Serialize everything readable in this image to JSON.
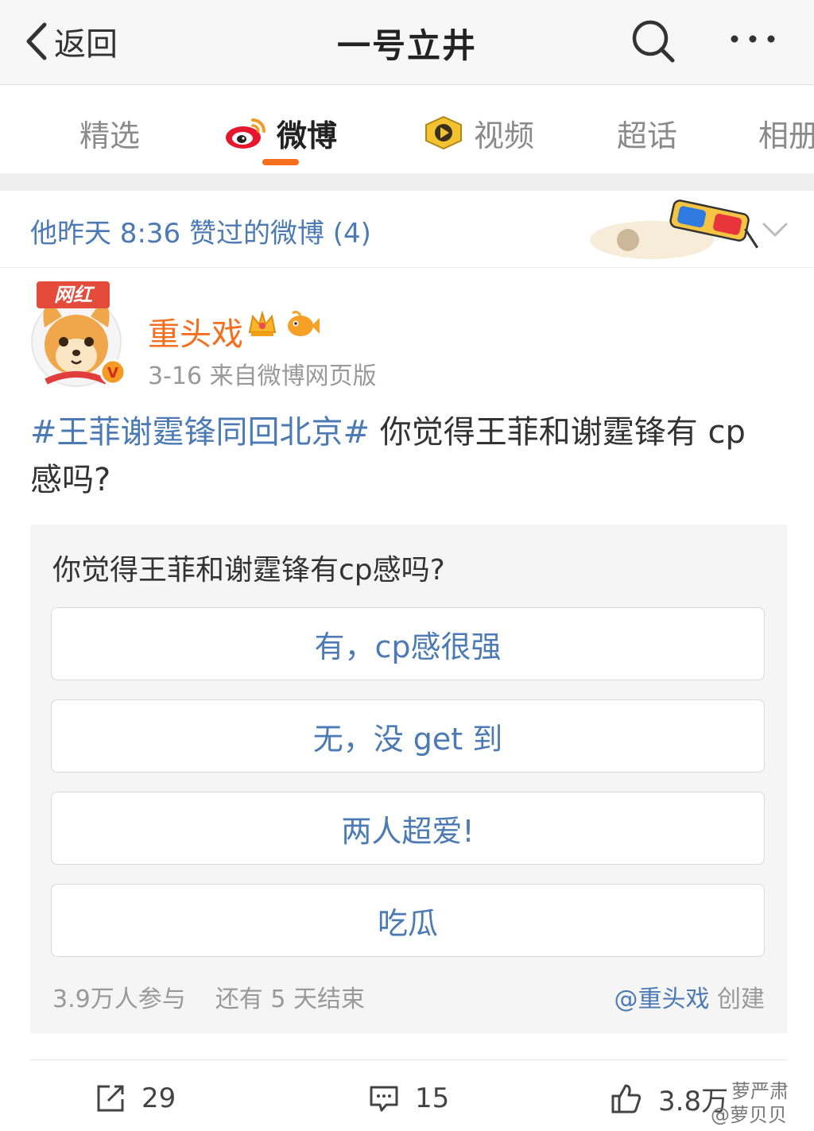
{
  "header": {
    "back_label": "返回",
    "title": "一号立井"
  },
  "tabs": [
    {
      "label": "精选"
    },
    {
      "label": "微博"
    },
    {
      "label": "视频"
    },
    {
      "label": "超话"
    },
    {
      "label": "相册"
    }
  ],
  "active_tab": "微博",
  "liked_banner": {
    "text": "他昨天 8:36 赞过的微博 (4)"
  },
  "post": {
    "avatar_badge": "网红",
    "author": "重头戏",
    "meta": "3-16  来自微博网页版",
    "hashtag": "#王菲谢霆锋同回北京#",
    "text": " 你觉得王菲和谢霆锋有 cp 感吗?"
  },
  "poll": {
    "question": "你觉得王菲和谢霆锋有cp感吗?",
    "options": [
      "有，cp感很强",
      "无，没 get 到",
      "两人超爱!",
      "吃瓜"
    ],
    "participants": "3.9万人参与",
    "remaining": "还有 5 天结束",
    "creator": "@重头戏",
    "created_label": " 创建"
  },
  "actions": {
    "repost_count": "29",
    "comment_count": "15",
    "like_count": "3.8万"
  },
  "watermark": {
    "line1": "萝严肃",
    "line2": "@萝贝贝"
  },
  "colors": {
    "accent": "#f56e1d",
    "link": "#4b7ab4"
  }
}
